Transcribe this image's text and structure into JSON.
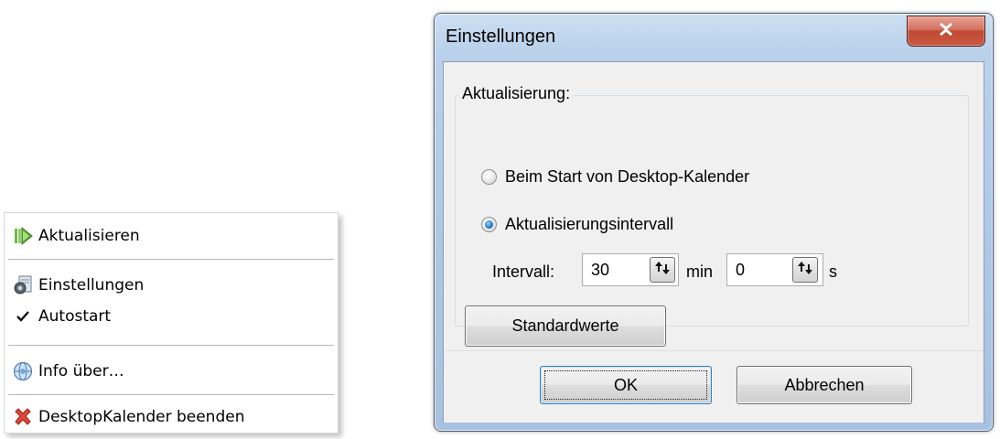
{
  "context_menu": {
    "items": [
      {
        "label": "Aktualisieren",
        "icon": "refresh-play-icon"
      },
      {
        "label": "Einstellungen",
        "icon": "settings-gear-document-icon"
      },
      {
        "label": "Autostart",
        "icon": "checkmark-icon",
        "checked": true
      },
      {
        "label": "Info über…",
        "icon": "info-globe-icon"
      },
      {
        "label": "DesktopKalender beenden",
        "icon": "red-x-icon"
      }
    ]
  },
  "dialog": {
    "title": "Einstellungen",
    "close_icon": "close-x-icon",
    "group": {
      "legend": "Aktualisierung:",
      "options": [
        {
          "label": "Beim Start von Desktop-Kalender",
          "selected": false
        },
        {
          "label": "Aktualisierungsintervall",
          "selected": true
        }
      ],
      "interval": {
        "label": "Intervall:",
        "minutes_value": "30",
        "minutes_unit": "min",
        "seconds_value": "0",
        "seconds_unit": "s"
      },
      "defaults_button": "Standardwerte"
    },
    "ok_button": "OK",
    "cancel_button": "Abbrechen"
  },
  "colors": {
    "title_bar": "#b9d1ea",
    "close_button": "#c04a33",
    "radio_selected": "#2d7ec8"
  }
}
